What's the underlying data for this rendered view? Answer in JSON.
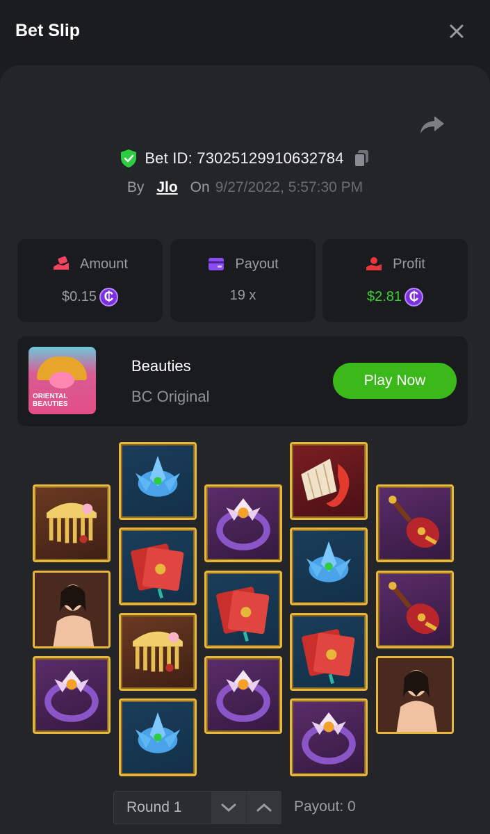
{
  "header": {
    "title": "Bet Slip"
  },
  "bet": {
    "id_label": "Bet ID: 73025129910632784",
    "by_label": "By",
    "user": "Jlo",
    "on_label": "On",
    "date": "9/27/2022, 5:57:30 PM"
  },
  "stats": {
    "amount": {
      "label": "Amount",
      "value": "$0.15",
      "icon": "money-hand-icon",
      "color": "#f0455f"
    },
    "payout": {
      "label": "Payout",
      "value": "19 x",
      "icon": "wallet-icon",
      "color": "#8a4df2"
    },
    "profit": {
      "label": "Profit",
      "value": "$2.81",
      "icon": "profit-hand-icon",
      "color": "#39d32f"
    }
  },
  "currency_symbol": "₵",
  "game": {
    "name": "Beauties",
    "provider": "BC Original",
    "thumb_text": "ORIENTAL BEAUTIES",
    "play_label": "Play Now"
  },
  "reels": [
    [
      "comb",
      "lady",
      "ring"
    ],
    [
      "lotus",
      "book",
      "comb",
      "lotus"
    ],
    [
      "ring",
      "book",
      "ring"
    ],
    [
      "fan",
      "lotus",
      "book",
      "ring"
    ],
    [
      "lute",
      "lute",
      "lady"
    ]
  ],
  "round": {
    "label": "Round 1",
    "payout_label": "Payout: 0"
  },
  "colors": {
    "accent_green": "#3bb81a",
    "tile_border": "#e6b73a",
    "panel_bg": "#232529"
  }
}
